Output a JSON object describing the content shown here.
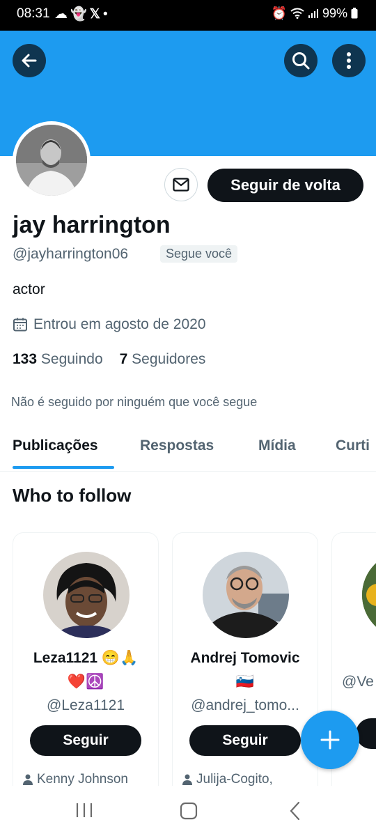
{
  "status_bar": {
    "time": "08:31",
    "left_icons": [
      "cloud-icon",
      "snapchat-icon",
      "x-icon",
      "dot-icon"
    ],
    "battery": "99%",
    "right_icons": [
      "alarm-icon",
      "wifi-icon",
      "signal-icon",
      "battery-icon"
    ]
  },
  "header": {
    "back_icon": "arrow-left-icon",
    "search_icon": "search-icon",
    "more_icon": "more-vertical-icon",
    "banner_color": "#1d9bf0"
  },
  "profile": {
    "name": "jay harrington",
    "handle": "@jayharrington06",
    "follows_you": "Segue você",
    "bio": "actor",
    "joined": "Entrou em agosto de 2020",
    "following_count": "133",
    "following_label": "Seguindo",
    "followers_count": "7",
    "followers_label": "Seguidores",
    "not_followed_by": "Não é seguido por ninguém que você segue",
    "follow_back_label": "Seguir de volta",
    "message_icon": "envelope-icon"
  },
  "tabs": [
    {
      "label": "Publicações",
      "active": true
    },
    {
      "label": "Respostas",
      "active": false
    },
    {
      "label": "Mídia",
      "active": false
    },
    {
      "label": "Curti",
      "active": false
    }
  ],
  "who_to_follow": {
    "title": "Who to follow",
    "cards": [
      {
        "name_line1": "Leza1121 😁🙏",
        "name_line2": "❤️☮️",
        "handle": "@Leza1121",
        "button": "Seguir",
        "followed_by": "Kenny Johnson"
      },
      {
        "name_line1": "Andrej Tomovic",
        "name_line2": "🇸🇮",
        "handle": "@andrej_tomo...",
        "button": "Seguir",
        "followed_by": "Julija-Cogito,"
      },
      {
        "handle": "@Ve"
      }
    ]
  },
  "fab_icon": "plus-icon",
  "nav_bar": [
    "recents-icon",
    "home-icon",
    "back-icon"
  ]
}
